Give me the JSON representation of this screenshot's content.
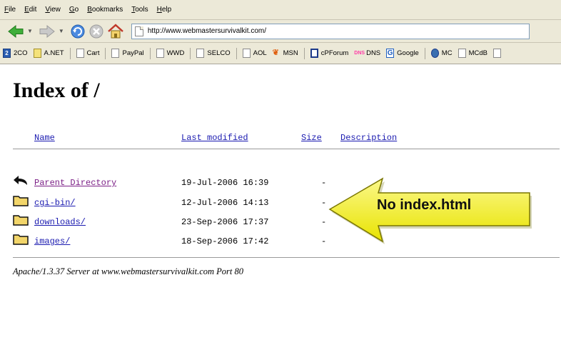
{
  "browser": {
    "menu": [
      "File",
      "Edit",
      "View",
      "Go",
      "Bookmarks",
      "Tools",
      "Help"
    ],
    "url": "http://www.webmastersurvivalkit.com/",
    "bookmarks": [
      {
        "label": "2CO",
        "icon": "square-badge-icon"
      },
      {
        "label": "A.NET",
        "icon": "yellow-folder-icon"
      },
      {
        "label": "Cart",
        "icon": "page-icon"
      },
      {
        "label": "PayPal",
        "icon": "page-icon"
      },
      {
        "label": "WWD",
        "icon": "page-icon"
      },
      {
        "label": "SELCO",
        "icon": "page-icon"
      },
      {
        "label": "AOL",
        "icon": "page-icon"
      },
      {
        "label": "MSN",
        "icon": "butterfly-icon"
      },
      {
        "label": "cPForum",
        "icon": "cp-icon"
      },
      {
        "label": "DNS",
        "icon": "dns-icon"
      },
      {
        "label": "Google",
        "icon": "google-icon"
      },
      {
        "label": "MC",
        "icon": "mc-icon"
      },
      {
        "label": "MCdB",
        "icon": "page-icon"
      }
    ]
  },
  "page": {
    "title": "Index of /",
    "columns": {
      "name": "Name",
      "last_modified": "Last modified",
      "size": "Size",
      "description": "Description"
    },
    "rows": [
      {
        "name": "Parent Directory",
        "date": "19-Jul-2006 16:39",
        "size": "-",
        "icon": "back-arrow-icon"
      },
      {
        "name": "cgi-bin/",
        "date": "12-Jul-2006 14:13",
        "size": "-",
        "icon": "folder-icon"
      },
      {
        "name": "downloads/",
        "date": "23-Sep-2006 17:37",
        "size": "-",
        "icon": "folder-icon"
      },
      {
        "name": "images/",
        "date": "18-Sep-2006 17:42",
        "size": "-",
        "icon": "folder-icon"
      }
    ],
    "footer": "Apache/1.3.37 Server at www.webmastersurvivalkit.com Port 80"
  },
  "callout": {
    "text": "No index.html",
    "color": "#f5f200"
  }
}
